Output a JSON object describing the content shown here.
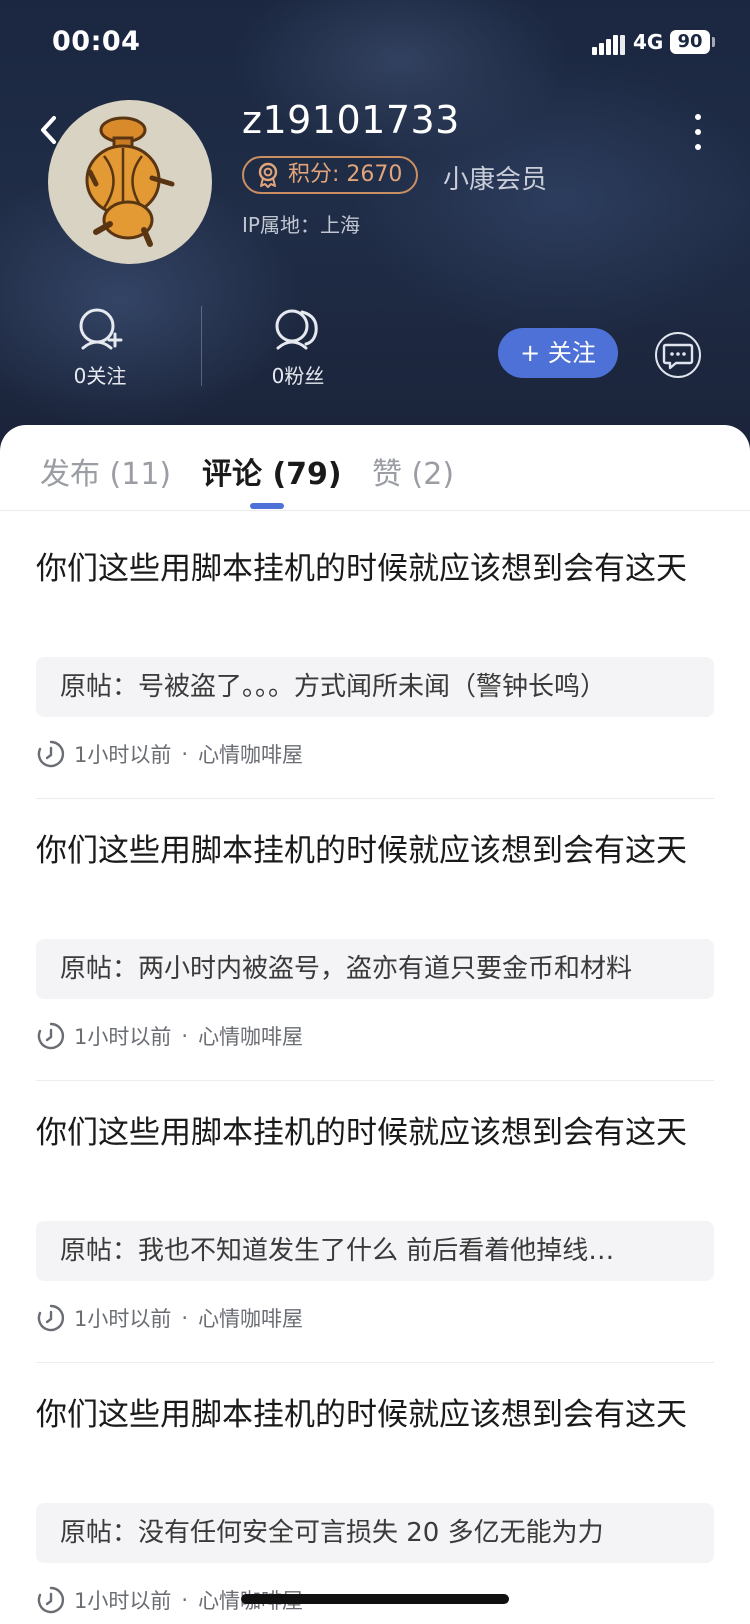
{
  "status_bar": {
    "time": "00:04",
    "network": "4G",
    "battery": "90"
  },
  "profile": {
    "username": "z19101733",
    "points": "积分: 2670",
    "member_level": "小康会员",
    "ip_location": "IP属地：上海"
  },
  "stats": {
    "following": "0关注",
    "followers": "0粉丝"
  },
  "actions": {
    "follow_label": "+ 关注"
  },
  "tabs": [
    {
      "label": "发布 (11)",
      "active": false
    },
    {
      "label": "评论 (79)",
      "active": true
    },
    {
      "label": "赞 (2)",
      "active": false
    }
  ],
  "comments": [
    {
      "text": "你们这些用脚本挂机的时候就应该想到会有这天",
      "quote": "原帖：号被盗了。。。方式闻所未闻（警钟长鸣）",
      "time": "1小时以前",
      "forum": "心情咖啡屋"
    },
    {
      "text": "你们这些用脚本挂机的时候就应该想到会有这天",
      "quote": "原帖：两小时内被盗号，盗亦有道只要金币和材料",
      "time": "1小时以前",
      "forum": "心情咖啡屋"
    },
    {
      "text": "你们这些用脚本挂机的时候就应该想到会有这天",
      "quote": "原帖：我也不知道发生了什么 前后看着他掉线…",
      "time": "1小时以前",
      "forum": "心情咖啡屋"
    },
    {
      "text": "你们这些用脚本挂机的时候就应该想到会有这天",
      "quote": "原帖：没有任何安全可言损失 20 多亿无能为力",
      "time": "1小时以前",
      "forum": "心情咖啡屋"
    }
  ],
  "meta_separator": "·",
  "colors": {
    "accent": "#4d71d6",
    "badge": "#c98e62",
    "header_bg": "#1b2740"
  }
}
